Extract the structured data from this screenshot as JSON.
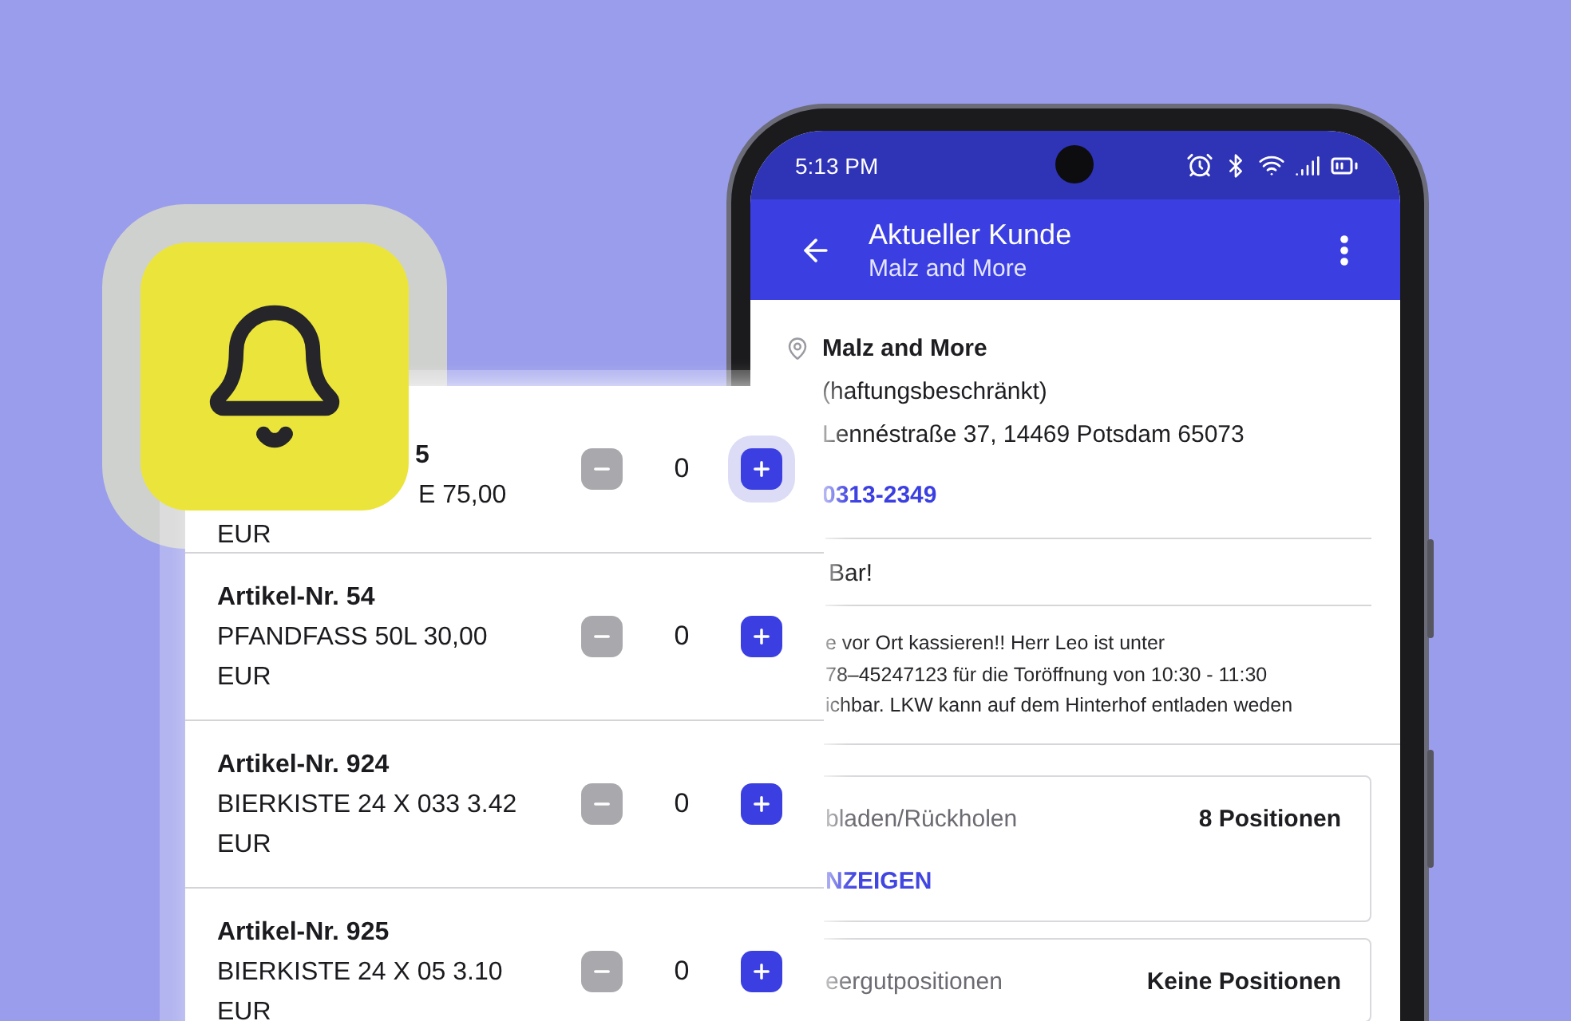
{
  "items": [
    {
      "kind": "covered",
      "title": "5",
      "lines": [
        "E 75,00",
        "EUR"
      ],
      "count": "0",
      "minus_disabled": true,
      "plus_focused": true
    },
    {
      "kind": "item",
      "title": "Artikel-Nr. 54",
      "lines": [
        "PFANDFASS 50L 30,00",
        "EUR"
      ],
      "count": "0",
      "minus_disabled": true,
      "plus_focused": false
    },
    {
      "kind": "item",
      "title": "Artikel-Nr. 924",
      "lines": [
        "BIERKISTE 24 X 033 3.42",
        "EUR"
      ],
      "count": "0",
      "minus_disabled": true,
      "plus_focused": false
    },
    {
      "kind": "item",
      "title": "Artikel-Nr. 925",
      "lines": [
        "BIERKISTE 24 X 05 3.10",
        "EUR"
      ],
      "count": "0",
      "minus_disabled": true,
      "plus_focused": false
    }
  ],
  "phone": {
    "status_time": "5:13 PM",
    "header": {
      "title": "Aktueller Kunde",
      "subtitle": "Malz and More"
    },
    "customer": {
      "name": "Malz and More",
      "lines": [
        "(haftungsbeschränkt)",
        "Lennéstraße 37, 14469 Potsdam 65073"
      ],
      "phone": "0313-2349"
    },
    "payment": "Bar!",
    "notes": [
      "e vor Ort kassieren!! Herr Leo ist unter",
      "78–45247123 für die Toröffnung von 10:30 - 11:30",
      "ichbar. LKW kann auf dem Hinterhof entladen weden"
    ],
    "sections": [
      {
        "label": "bladen/Rückholen",
        "value": "8 Positionen",
        "action": "NZEIGEN"
      },
      {
        "label": "eergutpositionen",
        "value": "Keine Positionen"
      }
    ]
  }
}
